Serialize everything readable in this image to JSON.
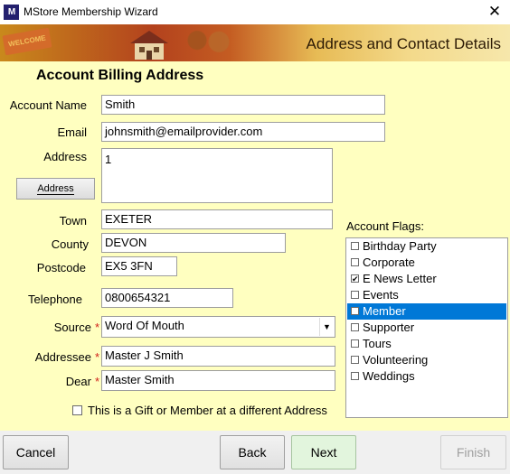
{
  "window": {
    "title": "MStore Membership Wizard",
    "icon_text": "M",
    "close_glyph": "✕"
  },
  "banner": {
    "title": "Address and Contact Details",
    "sign_text": "WELCOME"
  },
  "section": {
    "heading": "Account Billing Address"
  },
  "form": {
    "account_name_label": "Account Name",
    "account_name": "Smith",
    "email_label": "Email",
    "email": "johnsmith@emailprovider.com",
    "address_label": "Address",
    "address": "1",
    "address_button": "Address",
    "town_label": "Town",
    "town": "EXETER",
    "county_label": "County",
    "county": "DEVON",
    "postcode_label": "Postcode",
    "postcode": "EX5 3FN",
    "telephone_label": "Telephone",
    "telephone": "0800654321",
    "source_label": "Source",
    "source": "Word Of Mouth",
    "addressee_label": "Addressee",
    "addressee": "Master J Smith",
    "dear_label": "Dear",
    "dear": "Master Smith",
    "required_mark": "*",
    "gift_label": "This is a Gift or Member at a different Address"
  },
  "flags": {
    "label": "Account Flags:",
    "items": [
      {
        "label": "Birthday Party",
        "checked": false,
        "selected": false
      },
      {
        "label": "Corporate",
        "checked": false,
        "selected": false
      },
      {
        "label": "E News Letter",
        "checked": true,
        "selected": false
      },
      {
        "label": "Events",
        "checked": false,
        "selected": false
      },
      {
        "label": "Member",
        "checked": false,
        "selected": true
      },
      {
        "label": "Supporter",
        "checked": false,
        "selected": false
      },
      {
        "label": "Tours",
        "checked": false,
        "selected": false
      },
      {
        "label": "Volunteering",
        "checked": false,
        "selected": false
      },
      {
        "label": "Weddings",
        "checked": false,
        "selected": false
      }
    ]
  },
  "footer": {
    "cancel": "Cancel",
    "back": "Back",
    "next": "Next",
    "finish": "Finish"
  },
  "colors": {
    "panel": "#ffffc0",
    "selection": "#0078d7",
    "required": "#d0201a",
    "next_bg": "#e2f5dd"
  }
}
